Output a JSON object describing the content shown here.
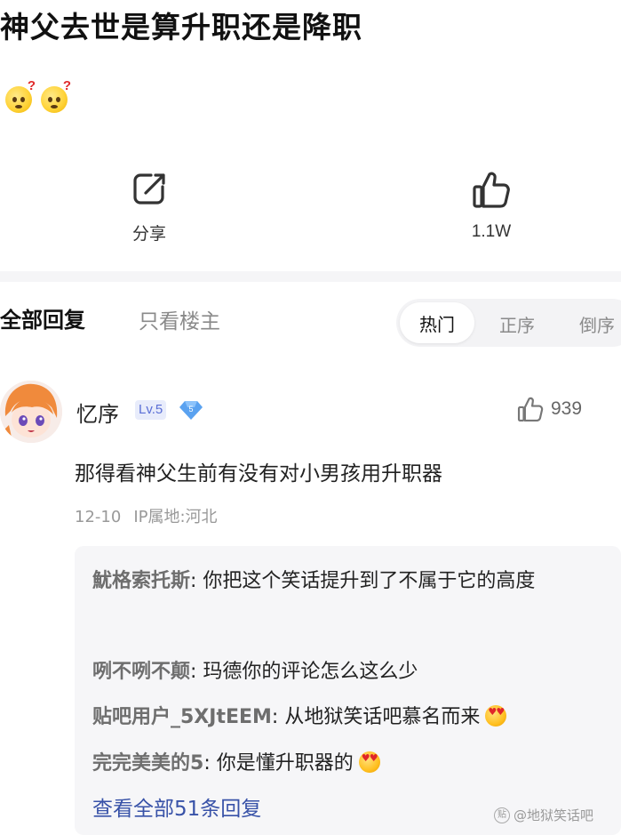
{
  "post": {
    "title": "神父去世是算升职还是降职",
    "emojis": [
      "thinking-face-question",
      "thinking-face-question"
    ]
  },
  "actions": {
    "share_label": "分享",
    "like_count": "1.1W"
  },
  "tabs": {
    "all_replies": "全部回复",
    "owner_only": "只看楼主",
    "sort": [
      "热门",
      "正序",
      "倒序"
    ],
    "active_sort": "热门"
  },
  "comment": {
    "username": "忆序",
    "level": "Lv.5",
    "vip_badge": "5",
    "likes": "939",
    "text": "那得看神父生前有没有对小男孩用升职器",
    "date": "12-10",
    "location": "IP属地:河北"
  },
  "replies": [
    {
      "user": "魷格索托斯",
      "text": "你把这个笑话提升到了不属于它的高度"
    },
    {
      "user": "咧不咧不颠",
      "text": "玛德你的评论怎么这么少"
    },
    {
      "user": "贴吧用户_5XJtEEM",
      "text": "从地狱笑话吧慕名而来"
    },
    {
      "user": "完完美美的5",
      "text": "你是懂升职器的"
    }
  ],
  "view_all_replies": "查看全部51条回复",
  "watermark": "@地狱笑话吧",
  "colors": {
    "link": "#3852a8",
    "level_badge": "#5b6fd6",
    "panel": "#f6f6f8"
  }
}
